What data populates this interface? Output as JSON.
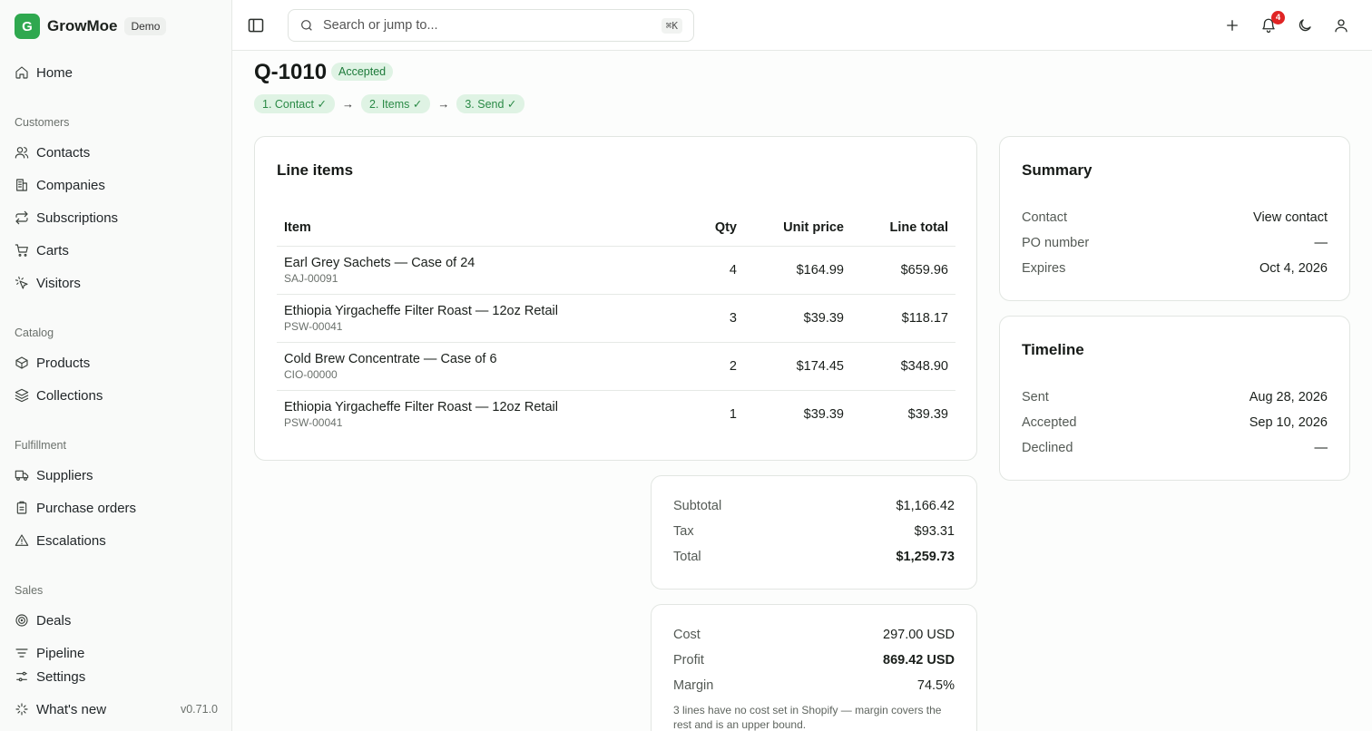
{
  "brand": {
    "logo_letter": "G",
    "name": "GrowMoe",
    "badge": "Demo",
    "accent": "#2fa84f"
  },
  "sidebar": {
    "home": {
      "label": "Home",
      "icon": "home-icon"
    },
    "groups": [
      {
        "label": "Customers",
        "items": [
          {
            "label": "Contacts",
            "icon": "users-icon"
          },
          {
            "label": "Companies",
            "icon": "building-icon"
          },
          {
            "label": "Subscriptions",
            "icon": "repeat-icon"
          },
          {
            "label": "Carts",
            "icon": "cart-icon"
          },
          {
            "label": "Visitors",
            "icon": "pointer-icon"
          }
        ]
      },
      {
        "label": "Catalog",
        "items": [
          {
            "label": "Products",
            "icon": "box-icon"
          },
          {
            "label": "Collections",
            "icon": "layers-icon"
          }
        ]
      },
      {
        "label": "Fulfillment",
        "items": [
          {
            "label": "Suppliers",
            "icon": "truck-icon"
          },
          {
            "label": "Purchase orders",
            "icon": "clipboard-icon"
          },
          {
            "label": "Escalations",
            "icon": "warning-icon"
          }
        ]
      },
      {
        "label": "Sales",
        "items": [
          {
            "label": "Deals",
            "icon": "target-icon"
          },
          {
            "label": "Pipeline",
            "icon": "pipeline-icon"
          }
        ]
      }
    ],
    "footer": {
      "settings": "Settings",
      "whats_new": "What's new",
      "version": "v0.71.0"
    }
  },
  "topbar": {
    "search_placeholder": "Search or jump to...",
    "search_shortcut": "⌘K",
    "notification_count": "4"
  },
  "quote": {
    "id": "Q-1010",
    "status": "Accepted",
    "steps": [
      "1. Contact ✓",
      "2. Items ✓",
      "3. Send ✓"
    ],
    "step_arrow": "→"
  },
  "line_items": {
    "title": "Line items",
    "columns": {
      "item": "Item",
      "qty": "Qty",
      "unit_price": "Unit price",
      "line_total": "Line total"
    },
    "rows": [
      {
        "name": "Earl Grey Sachets — Case of 24",
        "sku": "SAJ-00091",
        "qty": "4",
        "unit_price": "$164.99",
        "line_total": "$659.96"
      },
      {
        "name": "Ethiopia Yirgacheffe Filter Roast — 12oz Retail",
        "sku": "PSW-00041",
        "qty": "3",
        "unit_price": "$39.39",
        "line_total": "$118.17"
      },
      {
        "name": "Cold Brew Concentrate — Case of 6",
        "sku": "CIO-00000",
        "qty": "2",
        "unit_price": "$174.45",
        "line_total": "$348.90"
      },
      {
        "name": "Ethiopia Yirgacheffe Filter Roast — 12oz Retail",
        "sku": "PSW-00041",
        "qty": "1",
        "unit_price": "$39.39",
        "line_total": "$39.39"
      }
    ]
  },
  "totals": {
    "subtotal_label": "Subtotal",
    "subtotal": "$1,166.42",
    "tax_label": "Tax",
    "tax": "$93.31",
    "total_label": "Total",
    "total": "$1,259.73"
  },
  "profit": {
    "cost_label": "Cost",
    "cost": "297.00 USD",
    "profit_label": "Profit",
    "profit": "869.42 USD",
    "margin_label": "Margin",
    "margin": "74.5%",
    "note": "3 lines have no cost set in Shopify — margin covers the rest and is an upper bound."
  },
  "summary": {
    "title": "Summary",
    "contact_label": "Contact",
    "contact_link": "View contact",
    "po_label": "PO number",
    "po": "—",
    "expires_label": "Expires",
    "expires": "Oct 4, 2026"
  },
  "timeline": {
    "title": "Timeline",
    "sent_label": "Sent",
    "sent": "Aug 28, 2026",
    "accepted_label": "Accepted",
    "accepted": "Sep 10, 2026",
    "declined_label": "Declined",
    "declined": "—"
  }
}
